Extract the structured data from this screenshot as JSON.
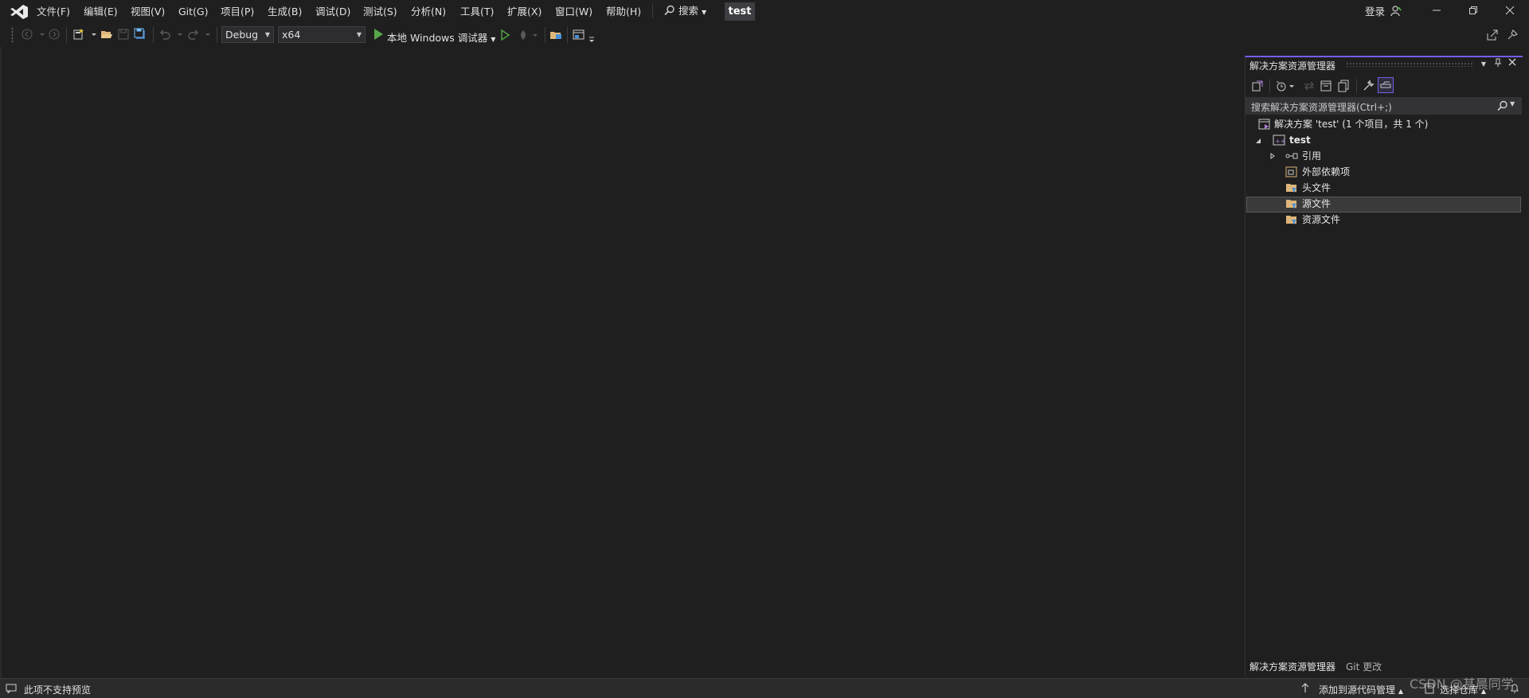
{
  "menu": {
    "items": [
      {
        "label": "文件(F)"
      },
      {
        "label": "编辑(E)"
      },
      {
        "label": "视图(V)"
      },
      {
        "label": "Git(G)"
      },
      {
        "label": "项目(P)"
      },
      {
        "label": "生成(B)"
      },
      {
        "label": "调试(D)"
      },
      {
        "label": "测试(S)"
      },
      {
        "label": "分析(N)"
      },
      {
        "label": "工具(T)"
      },
      {
        "label": "扩展(X)"
      },
      {
        "label": "窗口(W)"
      },
      {
        "label": "帮助(H)"
      }
    ],
    "search_label": "搜索",
    "solution_name": "test",
    "login_label": "登录"
  },
  "toolbar": {
    "configuration": "Debug",
    "platform": "x64",
    "run_label": "本地 Windows 调试器"
  },
  "solution_explorer": {
    "title": "解决方案资源管理器",
    "search_placeholder": "搜索解决方案资源管理器(Ctrl+;)",
    "tree": {
      "solution": "解决方案 'test' (1 个项目，共 1 个)",
      "project": "test",
      "references": "引用",
      "external_deps": "外部依赖项",
      "header_files": "头文件",
      "source_files": "源文件",
      "resource_files": "资源文件"
    },
    "tabs": [
      "解决方案资源管理器",
      "Git 更改"
    ]
  },
  "status_bar": {
    "left_text": "此项不支持预览",
    "add_source_control": "添加到源代码管理",
    "select_repo": "选择仓库"
  },
  "watermark": "CSDN @甚晨同学",
  "colors": {
    "accent": "#7160e8",
    "run_green": "#57a64a",
    "background": "#1f1f1f",
    "folder": "#dcb67a"
  }
}
